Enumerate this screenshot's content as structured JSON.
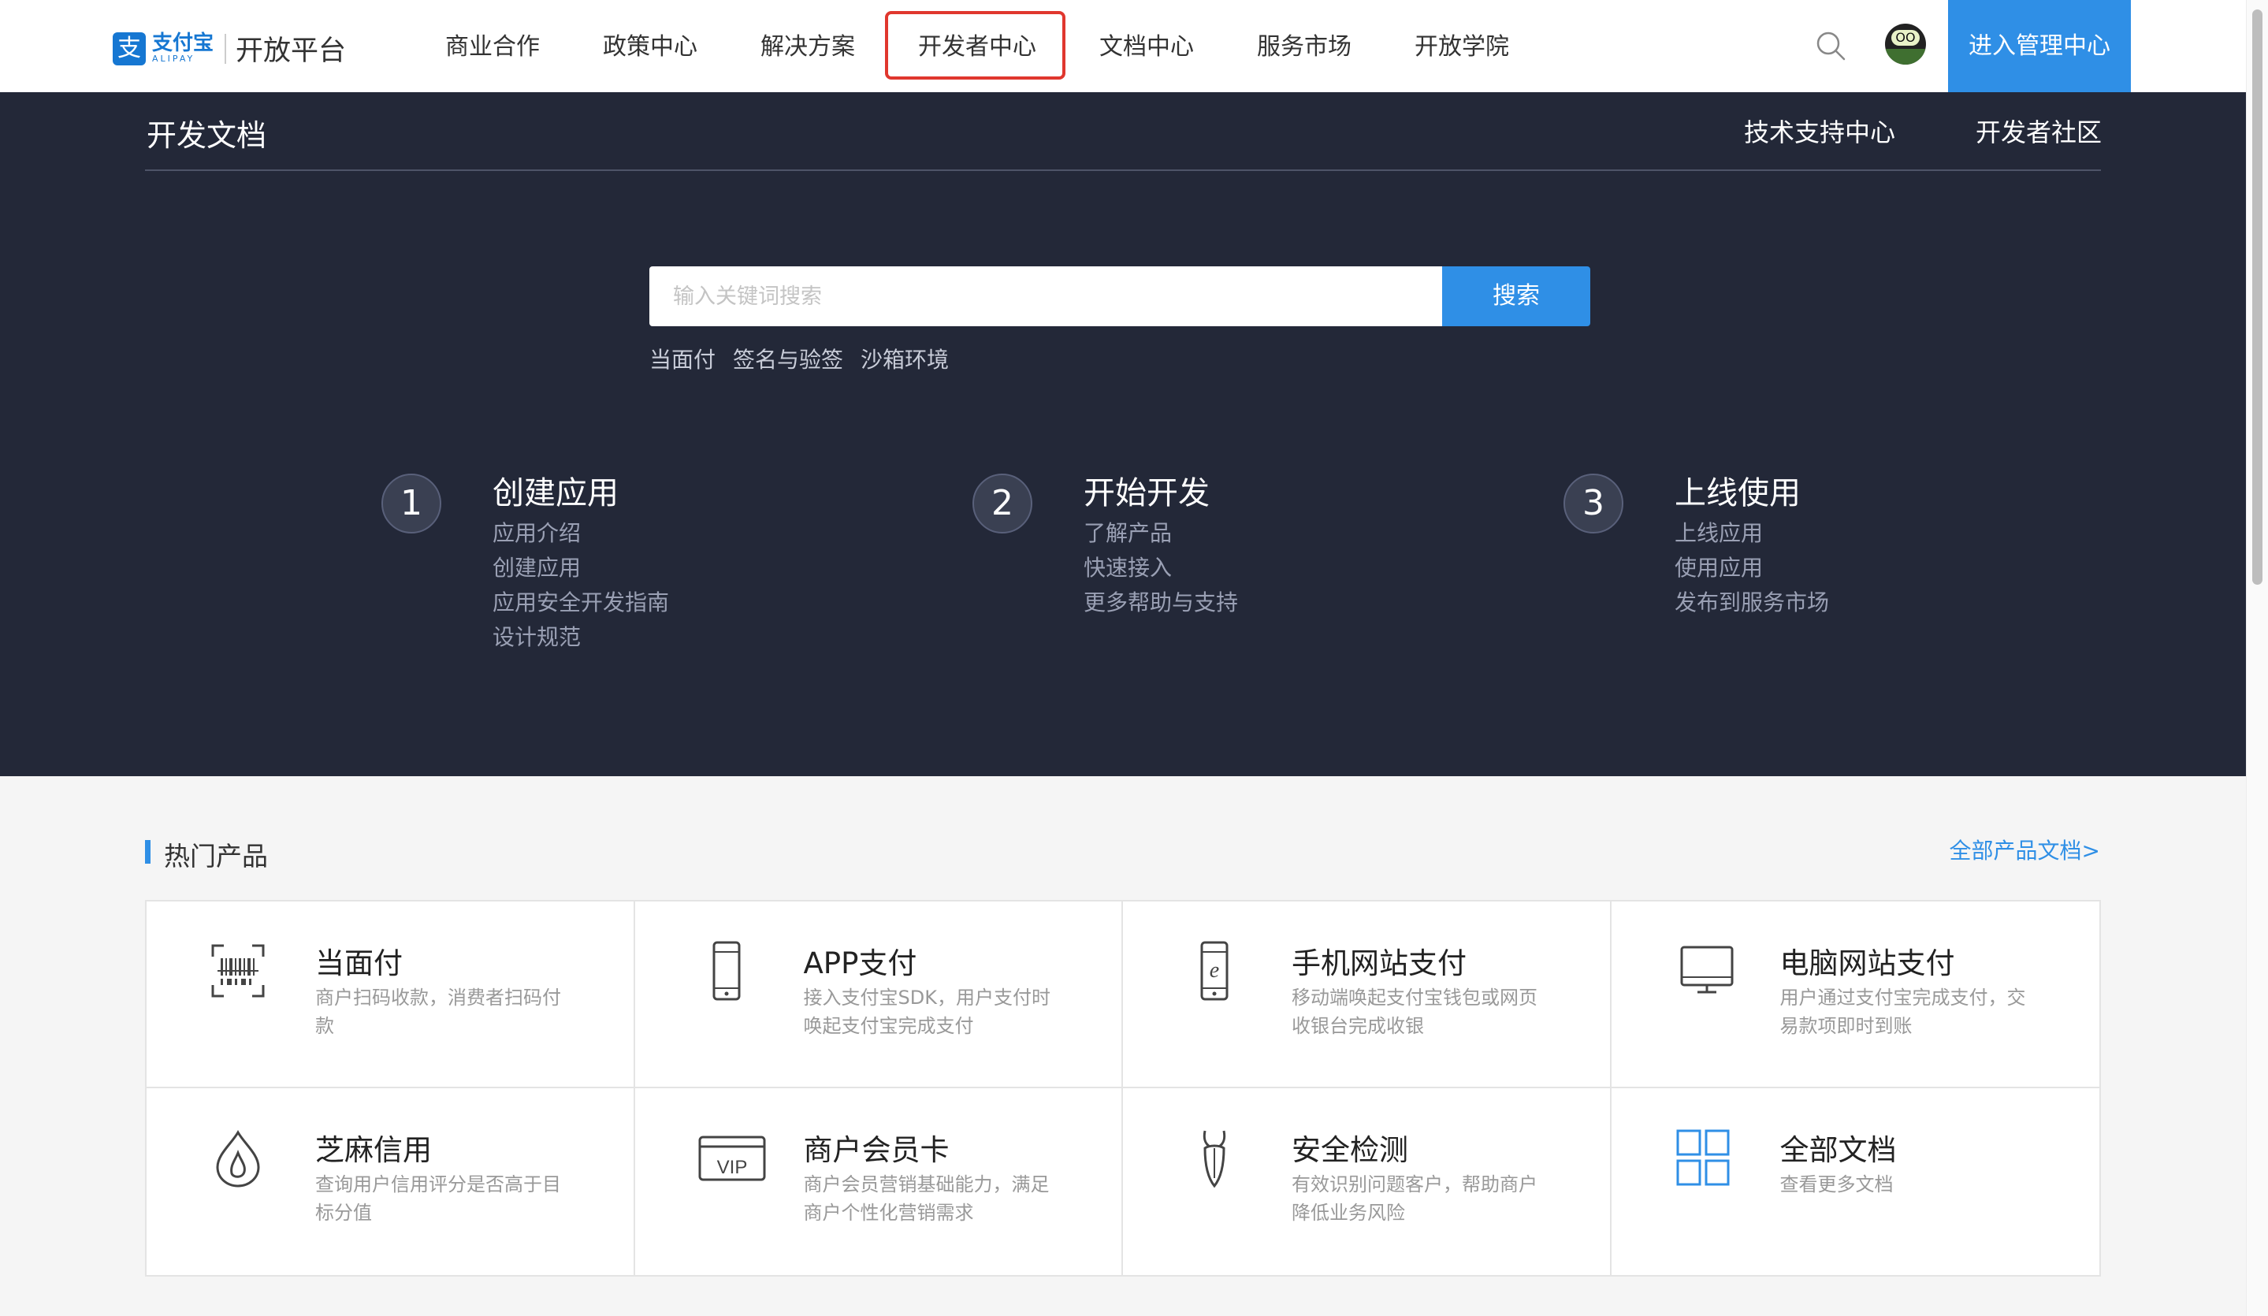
{
  "header": {
    "logo_mark": "支",
    "logo_cn": "支付宝",
    "logo_en": "ALIPAY",
    "platform": "开放平台",
    "nav": [
      "商业合作",
      "政策中心",
      "解决方案",
      "开发者中心",
      "文档中心",
      "服务市场",
      "开放学院"
    ],
    "active_nav": "开发者中心",
    "avatar_text": "OO",
    "admin_button": "进入管理中心"
  },
  "hero": {
    "title": "开发文档",
    "links": [
      "技术支持中心",
      "开发者社区"
    ],
    "search": {
      "placeholder": "输入关键词搜索",
      "button": "搜索"
    },
    "tags": [
      "当面付",
      "签名与验签",
      "沙箱环境"
    ],
    "steps": [
      {
        "num": "1",
        "title": "创建应用",
        "links": [
          "应用介绍",
          "创建应用",
          "应用安全开发指南",
          "设计规范"
        ]
      },
      {
        "num": "2",
        "title": "开始开发",
        "links": [
          "了解产品",
          "快速接入",
          "更多帮助与支持"
        ]
      },
      {
        "num": "3",
        "title": "上线使用",
        "links": [
          "上线应用",
          "使用应用",
          "发布到服务市场"
        ]
      }
    ]
  },
  "products": {
    "title": "热门产品",
    "more": "全部产品文档>",
    "vip_text": "VIP",
    "ie_text": "e",
    "items": [
      {
        "icon": "barcode-scan-icon",
        "title": "当面付",
        "desc": "商户扫码收款，消费者扫码付款"
      },
      {
        "icon": "mobile-phone-icon",
        "title": "APP支付",
        "desc": "接入支付宝SDK，用户支付时唤起支付宝完成支付"
      },
      {
        "icon": "mobile-browser-icon",
        "title": "手机网站支付",
        "desc": "移动端唤起支付宝钱包或网页收银台完成收银"
      },
      {
        "icon": "desktop-monitor-icon",
        "title": "电脑网站支付",
        "desc": "用户通过支付宝完成支付，交易款项即时到账"
      },
      {
        "icon": "sesame-drop-icon",
        "title": "芝麻信用",
        "desc": "查询用户信用评分是否高于目标分值"
      },
      {
        "icon": "vip-card-icon",
        "title": "商户会员卡",
        "desc": "商户会员营销基础能力，满足商户个性化营销需求"
      },
      {
        "icon": "security-bug-icon",
        "title": "安全检测",
        "desc": "有效识别问题客户，帮助商户降低业务风险"
      },
      {
        "icon": "grid-docs-icon",
        "title": "全部文档",
        "desc": "查看更多文档"
      }
    ]
  },
  "colors": {
    "brand_blue": "#2f8fe6",
    "hero_bg": "#232838",
    "active_outline": "#e0372e"
  }
}
